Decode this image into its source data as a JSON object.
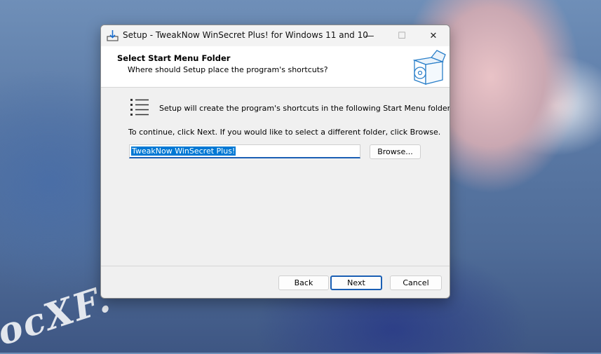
{
  "background": {
    "watermark_text": "ocXF."
  },
  "window": {
    "title": "Setup - TweakNow WinSecret Plus! for Windows 11 and 10",
    "controls": {
      "minimize": "—",
      "maximize": "☐",
      "close": "✕"
    }
  },
  "header": {
    "title": "Select Start Menu Folder",
    "subtitle": "Where should Setup place the program's shortcuts?"
  },
  "content": {
    "info_text": "Setup will create the program's shortcuts in the following Start Menu folder.",
    "continue_text": "To continue, click Next. If you would like to select a different folder, click Browse.",
    "folder_value": "TweakNow WinSecret Plus!",
    "browse_label": "Browse..."
  },
  "footer": {
    "back_label": "Back",
    "next_label": "Next",
    "cancel_label": "Cancel"
  },
  "colors": {
    "accent": "#1a5fb4",
    "selection": "#0078d4",
    "window_bg": "#f0f0f0"
  },
  "icons": {
    "app": "setup-install-icon",
    "header_graphic": "software-box-icon",
    "list": "start-menu-list-icon"
  }
}
